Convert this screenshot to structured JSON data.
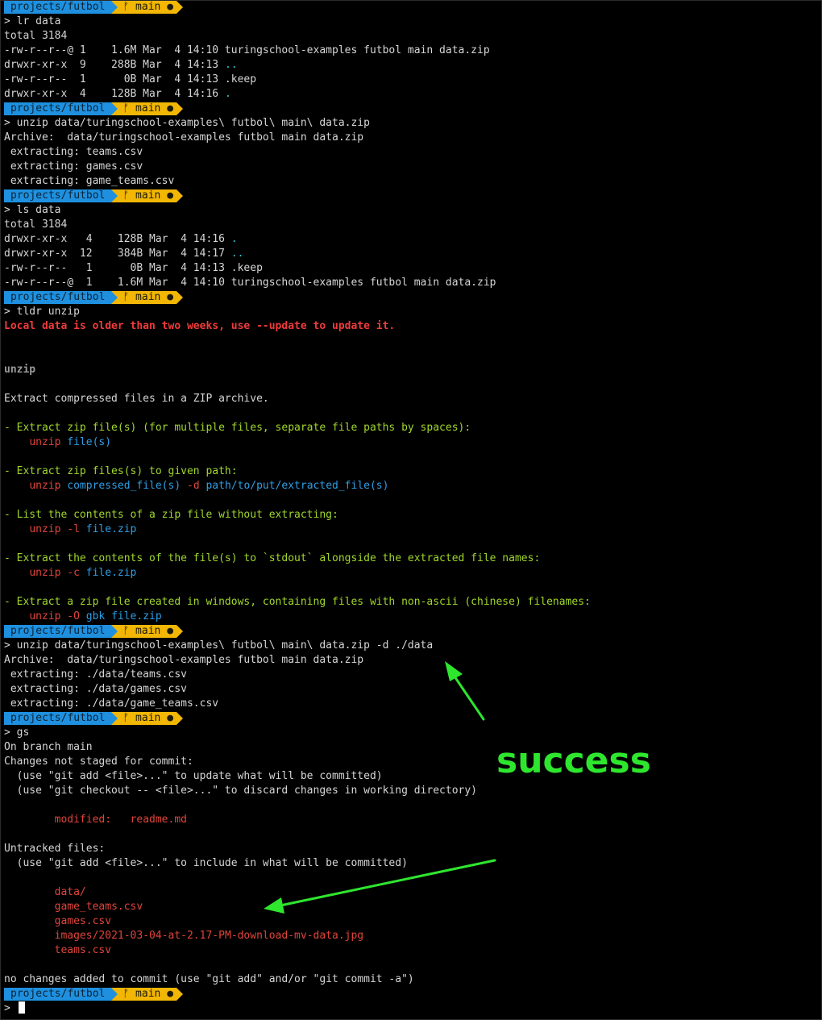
{
  "prompt": {
    "dir": "projects/futbol",
    "branch_glyph": "ᚠ",
    "branch": "main",
    "dirty": "●",
    "colors": {
      "dir_bg": "#1e90df",
      "branch_bg": "#f2b705"
    }
  },
  "lines": [
    {
      "type": "prompt"
    },
    {
      "segs": [
        [
          "> lr data",
          "default"
        ]
      ]
    },
    {
      "segs": [
        [
          "total 3184",
          "default"
        ]
      ]
    },
    {
      "segs": [
        [
          "-rw-r--r--@ 1    1.6M Mar  4 14:10 turingschool-examples futbol main data.zip",
          "default"
        ]
      ]
    },
    {
      "segs": [
        [
          "drwxr-xr-x  9    288B Mar  4 14:13 ",
          "default"
        ],
        [
          "..",
          "cyan"
        ]
      ]
    },
    {
      "segs": [
        [
          "-rw-r--r--  1      0B Mar  4 14:13 .keep",
          "default"
        ]
      ]
    },
    {
      "segs": [
        [
          "drwxr-xr-x  4    128B Mar  4 14:16 ",
          "default"
        ],
        [
          ".",
          "cyan"
        ]
      ]
    },
    {
      "type": "prompt"
    },
    {
      "segs": [
        [
          "> unzip data/turingschool-examples\\ futbol\\ main\\ data.zip",
          "default"
        ]
      ]
    },
    {
      "segs": [
        [
          "Archive:  data/turingschool-examples futbol main data.zip",
          "default"
        ]
      ]
    },
    {
      "segs": [
        [
          " extracting: teams.csv",
          "default"
        ]
      ]
    },
    {
      "segs": [
        [
          " extracting: games.csv",
          "default"
        ]
      ]
    },
    {
      "segs": [
        [
          " extracting: game_teams.csv",
          "default"
        ]
      ]
    },
    {
      "type": "prompt"
    },
    {
      "segs": [
        [
          "> ls data",
          "default"
        ]
      ]
    },
    {
      "segs": [
        [
          "total 3184",
          "default"
        ]
      ]
    },
    {
      "segs": [
        [
          "drwxr-xr-x   4    128B Mar  4 14:16 ",
          "default"
        ],
        [
          ".",
          "cyan"
        ]
      ]
    },
    {
      "segs": [
        [
          "drwxr-xr-x  12    384B Mar  4 14:17 ",
          "default"
        ],
        [
          "..",
          "cyan"
        ]
      ]
    },
    {
      "segs": [
        [
          "-rw-r--r--   1      0B Mar  4 14:13 .keep",
          "default"
        ]
      ]
    },
    {
      "segs": [
        [
          "-rw-r--r--@  1    1.6M Mar  4 14:10 turingschool-examples futbol main data.zip",
          "default"
        ]
      ]
    },
    {
      "type": "prompt"
    },
    {
      "segs": [
        [
          "> tldr unzip",
          "default"
        ]
      ]
    },
    {
      "segs": [
        [
          "Local data is older than two weeks, use --update to update it.",
          "redbold"
        ]
      ]
    },
    {
      "segs": []
    },
    {
      "segs": []
    },
    {
      "segs": [
        [
          "unzip",
          "graybold"
        ]
      ]
    },
    {
      "segs": []
    },
    {
      "segs": [
        [
          "Extract compressed files in a ZIP archive.",
          "default"
        ]
      ]
    },
    {
      "segs": []
    },
    {
      "segs": [
        [
          "- Extract zip file(s) (for multiple files, separate file paths by spaces):",
          "green"
        ]
      ]
    },
    {
      "segs": [
        [
          "    ",
          "default"
        ],
        [
          "unzip",
          "red"
        ],
        [
          " ",
          "default"
        ],
        [
          "file(s)",
          "blue"
        ]
      ]
    },
    {
      "segs": []
    },
    {
      "segs": [
        [
          "- Extract zip files(s) to given path:",
          "green"
        ]
      ]
    },
    {
      "segs": [
        [
          "    ",
          "default"
        ],
        [
          "unzip",
          "red"
        ],
        [
          " ",
          "default"
        ],
        [
          "compressed_file(s)",
          "blue"
        ],
        [
          " -d ",
          "red"
        ],
        [
          "path/to/put/extracted_file(s)",
          "blue"
        ]
      ]
    },
    {
      "segs": []
    },
    {
      "segs": [
        [
          "- List the contents of a zip file without extracting:",
          "green"
        ]
      ]
    },
    {
      "segs": [
        [
          "    ",
          "default"
        ],
        [
          "unzip -l",
          "red"
        ],
        [
          " ",
          "default"
        ],
        [
          "file.zip",
          "blue"
        ]
      ]
    },
    {
      "segs": []
    },
    {
      "segs": [
        [
          "- Extract the contents of the file(s) to `stdout` alongside the extracted file names:",
          "green"
        ]
      ]
    },
    {
      "segs": [
        [
          "    ",
          "default"
        ],
        [
          "unzip -c",
          "red"
        ],
        [
          " ",
          "default"
        ],
        [
          "file.zip",
          "blue"
        ]
      ]
    },
    {
      "segs": []
    },
    {
      "segs": [
        [
          "- Extract a zip file created in windows, containing files with non-ascii (chinese) filenames:",
          "green"
        ]
      ]
    },
    {
      "segs": [
        [
          "    ",
          "default"
        ],
        [
          "unzip -O",
          "red"
        ],
        [
          " ",
          "default"
        ],
        [
          "gbk",
          "blue"
        ],
        [
          " ",
          "default"
        ],
        [
          "file.zip",
          "blue"
        ]
      ]
    },
    {
      "type": "prompt"
    },
    {
      "segs": [
        [
          "> unzip data/turingschool-examples\\ futbol\\ main\\ data.zip -d ./data",
          "default"
        ]
      ]
    },
    {
      "segs": [
        [
          "Archive:  data/turingschool-examples futbol main data.zip",
          "default"
        ]
      ]
    },
    {
      "segs": [
        [
          " extracting: ./data/teams.csv",
          "default"
        ]
      ]
    },
    {
      "segs": [
        [
          " extracting: ./data/games.csv",
          "default"
        ]
      ]
    },
    {
      "segs": [
        [
          " extracting: ./data/game_teams.csv",
          "default"
        ]
      ]
    },
    {
      "type": "prompt"
    },
    {
      "segs": [
        [
          "> gs",
          "default"
        ]
      ]
    },
    {
      "segs": [
        [
          "On branch main",
          "default"
        ]
      ]
    },
    {
      "segs": [
        [
          "Changes not staged for commit:",
          "default"
        ]
      ]
    },
    {
      "segs": [
        [
          "  (use \"git add <file>...\" to update what will be committed)",
          "default"
        ]
      ]
    },
    {
      "segs": [
        [
          "  (use \"git checkout -- <file>...\" to discard changes in working directory)",
          "default"
        ]
      ]
    },
    {
      "segs": []
    },
    {
      "segs": [
        [
          "        ",
          "default"
        ],
        [
          "modified:   readme.md",
          "red"
        ]
      ]
    },
    {
      "segs": []
    },
    {
      "segs": [
        [
          "Untracked files:",
          "default"
        ]
      ]
    },
    {
      "segs": [
        [
          "  (use \"git add <file>...\" to include in what will be committed)",
          "default"
        ]
      ]
    },
    {
      "segs": []
    },
    {
      "segs": [
        [
          "        ",
          "default"
        ],
        [
          "data/",
          "red"
        ]
      ]
    },
    {
      "segs": [
        [
          "        ",
          "default"
        ],
        [
          "game_teams.csv",
          "red"
        ]
      ]
    },
    {
      "segs": [
        [
          "        ",
          "default"
        ],
        [
          "games.csv",
          "red"
        ]
      ]
    },
    {
      "segs": [
        [
          "        ",
          "default"
        ],
        [
          "images/2021-03-04-at-2.17-PM-download-mv-data.jpg",
          "red"
        ]
      ]
    },
    {
      "segs": [
        [
          "        ",
          "default"
        ],
        [
          "teams.csv",
          "red"
        ]
      ]
    },
    {
      "segs": []
    },
    {
      "segs": [
        [
          "no changes added to commit (use \"git add\" and/or \"git commit -a\")",
          "default"
        ]
      ]
    },
    {
      "type": "prompt"
    },
    {
      "type": "input",
      "segs": [
        [
          "> ",
          "default"
        ]
      ]
    }
  ],
  "annotation": {
    "label": "success",
    "color": "#2ee62e"
  }
}
